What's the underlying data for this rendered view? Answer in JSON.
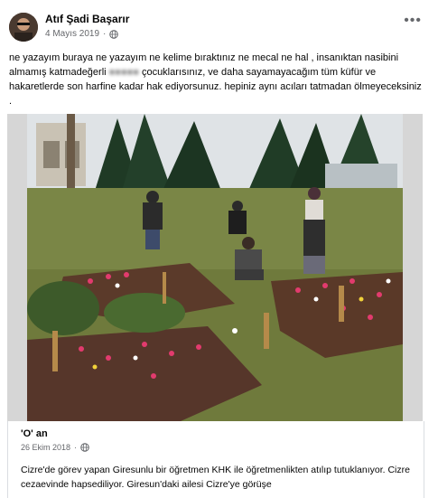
{
  "post": {
    "author": "Atıf Şadi Başarır",
    "date": "4 Mayıs 2019",
    "privacy_icon": "globe-icon",
    "more_icon": "more-options-icon",
    "text_part1": "ne yazayım buraya ne yazayım ne kelime bıraktınız ne mecal ne hal , insanıktan nasibini almamış katmadeğerli ",
    "text_blurred": "",
    "text_part2": " çocuklarısınız, ve daha sayamayacağım tüm küfür ve hakaretlerde son harfine kadar hak ediyorsunuz. hepiniz aynı acıları tatmadan ölmeyeceksiniz ."
  },
  "shared_post": {
    "author": "'O' an",
    "date": "26 Ekim 2018",
    "privacy_icon": "globe-icon",
    "text": "Cizre'de görev yapan Giresunlu bir öğretmen KHK ile öğretmenlikten atılıp tutuklanıyor. Cizre cezaevinde hapsediliyor. Giresun'daki ailesi Cizre'ye görüşe"
  },
  "colors": {
    "text": "#050505",
    "secondary": "#65676b",
    "border": "#dadde1"
  }
}
